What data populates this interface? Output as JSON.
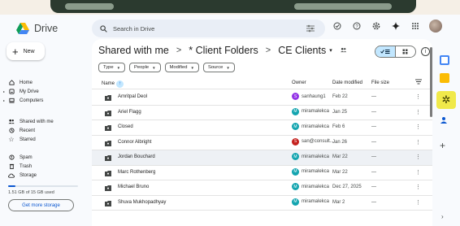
{
  "app": {
    "name": "Drive"
  },
  "search": {
    "placeholder": "Search in Drive"
  },
  "top_icons": [
    "offline-status-icon",
    "help-icon",
    "settings-icon",
    "gemini-icon",
    "apps-grid-icon",
    "account-avatar"
  ],
  "sidebar": {
    "new_label": "New",
    "items": [
      {
        "label": "Home",
        "icon": "home-icon"
      },
      {
        "label": "My Drive",
        "icon": "my-drive-icon",
        "expandable": true
      },
      {
        "label": "Computers",
        "icon": "computers-icon",
        "expandable": true
      },
      {
        "label": "Shared with me",
        "icon": "shared-icon"
      },
      {
        "label": "Recent",
        "icon": "recent-icon"
      },
      {
        "label": "Starred",
        "icon": "star-icon"
      },
      {
        "label": "Spam",
        "icon": "spam-icon"
      },
      {
        "label": "Trash",
        "icon": "trash-icon"
      },
      {
        "label": "Storage",
        "icon": "cloud-icon"
      }
    ],
    "storage_text": "1.51 GB of 15 GB used",
    "storage_fraction": 0.1,
    "get_storage_label": "Get more storage"
  },
  "breadcrumb": {
    "root": "Shared with me",
    "sep1": ">",
    "folder": "* Client Folders",
    "sep2": ">",
    "current": "CE Clients",
    "dropdown": "▾"
  },
  "filters": [
    {
      "label": "Type"
    },
    {
      "label": "People"
    },
    {
      "label": "Modified"
    },
    {
      "label": "Source"
    }
  ],
  "columns": {
    "name": "Name",
    "owner": "Owner",
    "date_modified": "Date modified",
    "file_size": "File size"
  },
  "rows": [
    {
      "name": "Amritpal Deol",
      "owner": "sanhaung1",
      "owner_initial": "S",
      "owner_color": "#9334e6",
      "date": "Feb 22",
      "size": "—"
    },
    {
      "name": "Ariel Flagg",
      "owner": "miramalekca",
      "owner_initial": "M",
      "owner_color": "#12a4af",
      "date": "Jan 25",
      "size": "—"
    },
    {
      "name": "Closed",
      "owner": "miramalekca",
      "owner_initial": "M",
      "owner_color": "#12a4af",
      "date": "Feb 6",
      "size": "—"
    },
    {
      "name": "Connor Albright",
      "owner": "san@consult...",
      "owner_initial": "S",
      "owner_color": "#c5221f",
      "date": "Jan 26",
      "size": "—"
    },
    {
      "name": "Jordan Bouchard",
      "owner": "miramalekca",
      "owner_initial": "M",
      "owner_color": "#12a4af",
      "date": "Mar 22",
      "size": "—",
      "selected": true
    },
    {
      "name": "Marc Rothenberg",
      "owner": "miramalekca",
      "owner_initial": "M",
      "owner_color": "#12a4af",
      "date": "Mar 22",
      "size": "—"
    },
    {
      "name": "Michael Bruno",
      "owner": "miramalekca",
      "owner_initial": "M",
      "owner_color": "#12a4af",
      "date": "Dec 27, 2025",
      "size": "—"
    },
    {
      "name": "Shuva Mukhopadhyay",
      "owner": "miramalekca",
      "owner_initial": "M",
      "owner_color": "#12a4af",
      "date": "Mar 2",
      "size": "—"
    }
  ],
  "colors": {
    "accent": "#0b57d0",
    "selected_toggle": "#c2e7ff",
    "keep": "#fbbc04",
    "calendar": "#4285f4",
    "tasks": "#0b57d0"
  },
  "side_panel": [
    "calendar-icon",
    "keep-icon",
    "gemini-spark-icon",
    "contacts-icon",
    "add-icon"
  ]
}
